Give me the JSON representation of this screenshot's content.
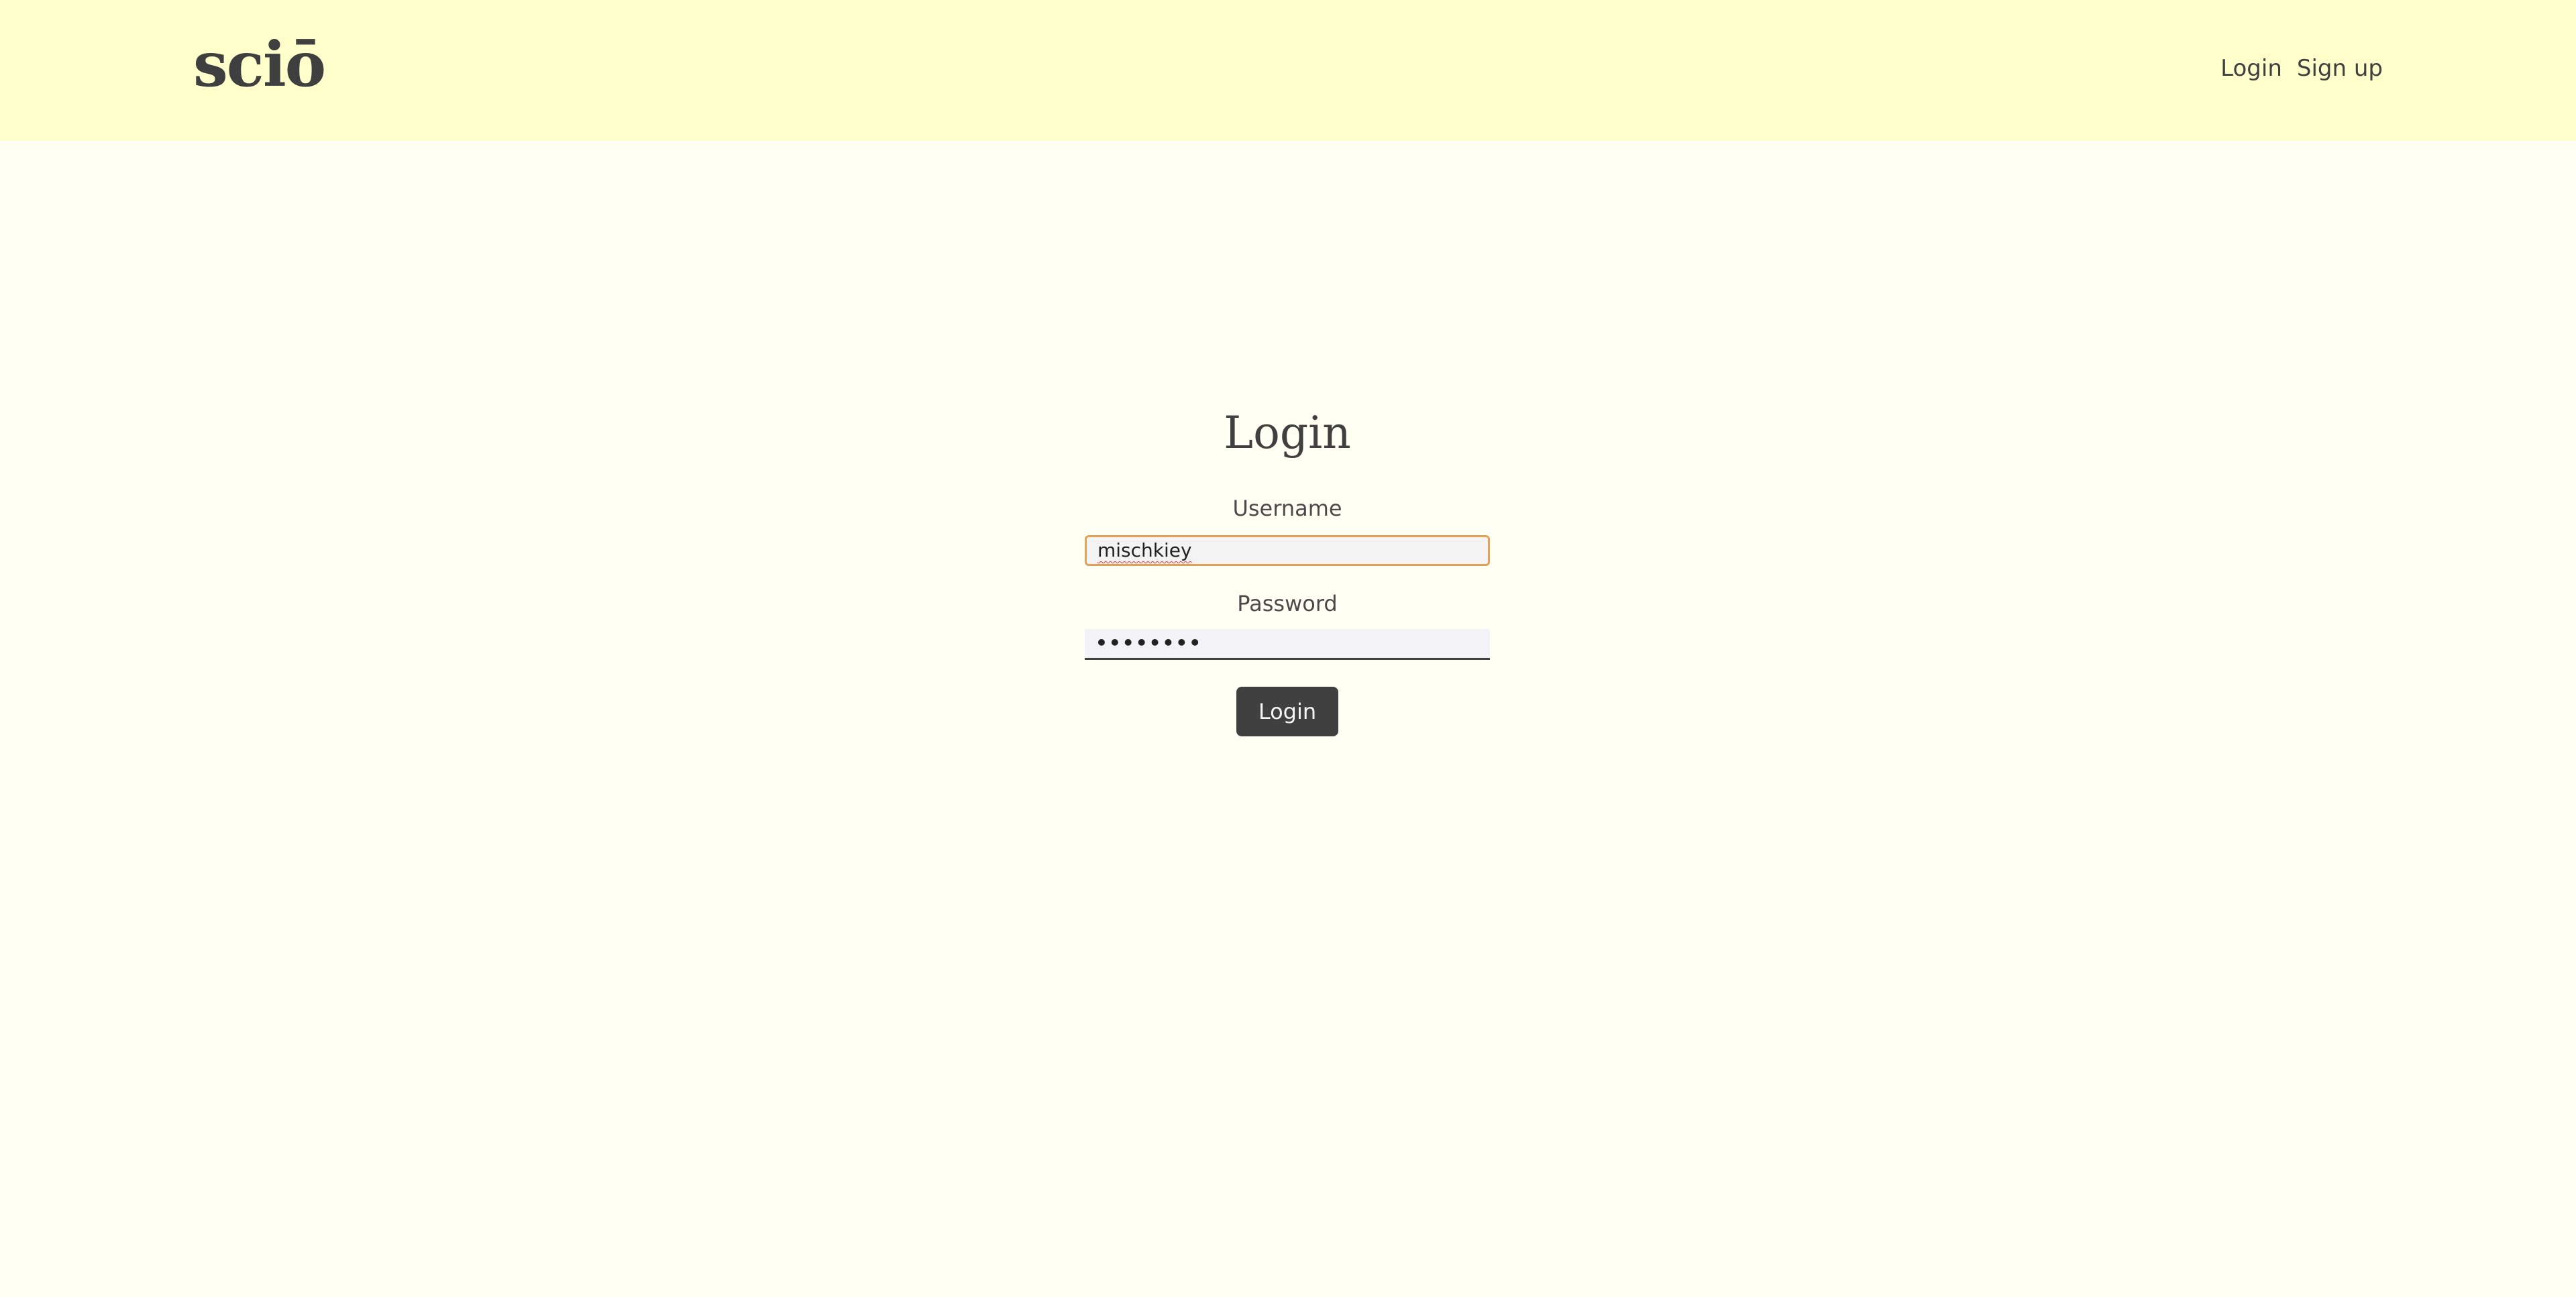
{
  "header": {
    "logo": "sciō",
    "nav": {
      "login": "Login",
      "signup": "Sign up"
    }
  },
  "form": {
    "title": "Login",
    "username_label": "Username",
    "username_value": "mischkiey",
    "password_label": "Password",
    "password_value": "••••••••",
    "submit_label": "Login"
  },
  "colors": {
    "header_bg": "#ffffcc",
    "page_bg": "#fffff3",
    "focus_border": "#e2a25a",
    "button_bg": "#404040"
  }
}
